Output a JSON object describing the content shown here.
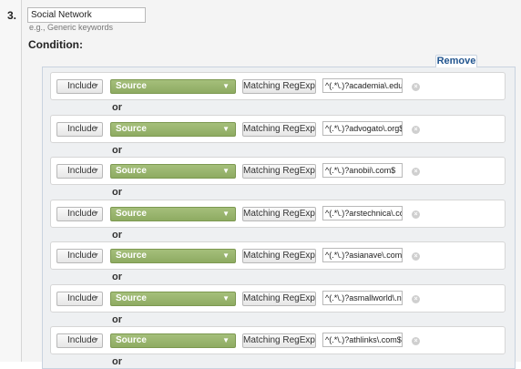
{
  "step_number": "3.",
  "filter_name": {
    "value": "Social Network",
    "hint": "e.g., Generic keywords"
  },
  "condition_label": "Condition:",
  "remove_label": "Remove",
  "or_label": "or",
  "clear_icon": "close-circle-icon",
  "rows": [
    {
      "include": "Include",
      "source": "Source",
      "match": "Matching RegExp",
      "regex": "^(.*\\.)?academia\\.edu$"
    },
    {
      "include": "Include",
      "source": "Source",
      "match": "Matching RegExp",
      "regex": "^(.*\\.)?advogato\\.org$"
    },
    {
      "include": "Include",
      "source": "Source",
      "match": "Matching RegExp",
      "regex": "^(.*\\.)?anobii\\.com$"
    },
    {
      "include": "Include",
      "source": "Source",
      "match": "Matching RegExp",
      "regex": "^(.*\\.)?arstechnica\\.com"
    },
    {
      "include": "Include",
      "source": "Source",
      "match": "Matching RegExp",
      "regex": "^(.*\\.)?asianave\\.com$"
    },
    {
      "include": "Include",
      "source": "Source",
      "match": "Matching RegExp",
      "regex": "^(.*\\.)?asmallworld\\.net$"
    },
    {
      "include": "Include",
      "source": "Source",
      "match": "Matching RegExp",
      "regex": "^(.*\\.)?athlinks\\.com$"
    }
  ],
  "colors": {
    "source_green": "#96b36b",
    "remove_link": "#22558f"
  }
}
